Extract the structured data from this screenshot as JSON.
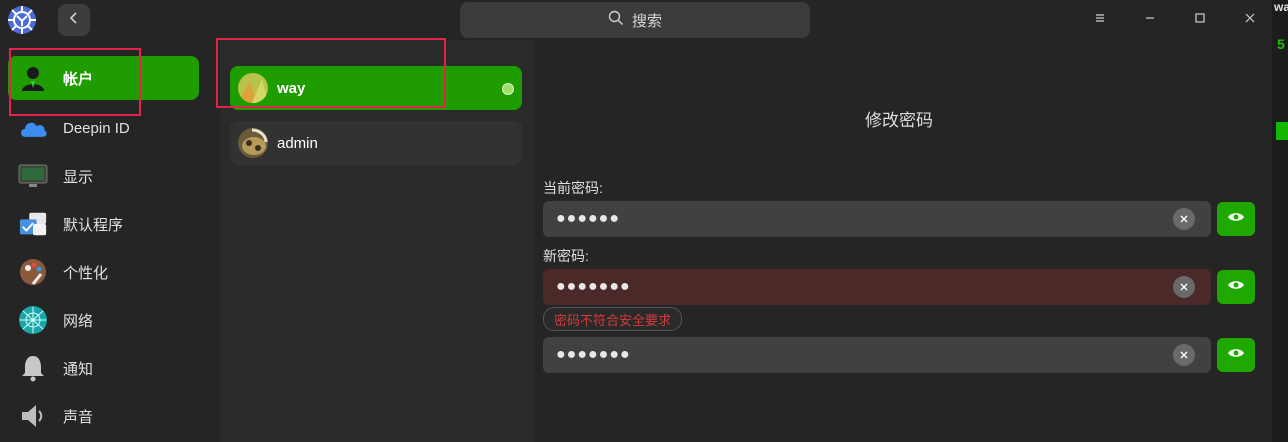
{
  "titlebar": {
    "search_placeholder": "搜索",
    "icons": [
      "settings-logo-icon",
      "back-chevron-icon",
      "search-icon",
      "menu-icon",
      "minimize-icon",
      "maximize-icon",
      "close-icon"
    ]
  },
  "sidebar": {
    "items": [
      {
        "label": "帐户",
        "icon": "account-icon",
        "active": true
      },
      {
        "label": "Deepin ID",
        "icon": "cloud-icon"
      },
      {
        "label": "显示",
        "icon": "display-icon"
      },
      {
        "label": "默认程序",
        "icon": "default-apps-icon"
      },
      {
        "label": "个性化",
        "icon": "personalization-icon"
      },
      {
        "label": "网络",
        "icon": "network-icon"
      },
      {
        "label": "通知",
        "icon": "bell-icon"
      },
      {
        "label": "声音",
        "icon": "speaker-icon"
      }
    ]
  },
  "accounts": [
    {
      "name": "way",
      "active": true,
      "online": true
    },
    {
      "name": "admin",
      "active": false
    }
  ],
  "form": {
    "title": "修改密码",
    "current_label": "当前密码:",
    "current_value": "●●●●●●",
    "new_label": "新密码:",
    "new_value": "●●●●●●●",
    "repeat_value": "●●●●●●●",
    "error_tip": "密码不符合安全要求"
  },
  "edge": {
    "text_a": "wa",
    "text_b": "5"
  },
  "colors": {
    "accent": "#1f9c00",
    "error": "#d33b3b",
    "highlight_box": "#e0254a"
  }
}
